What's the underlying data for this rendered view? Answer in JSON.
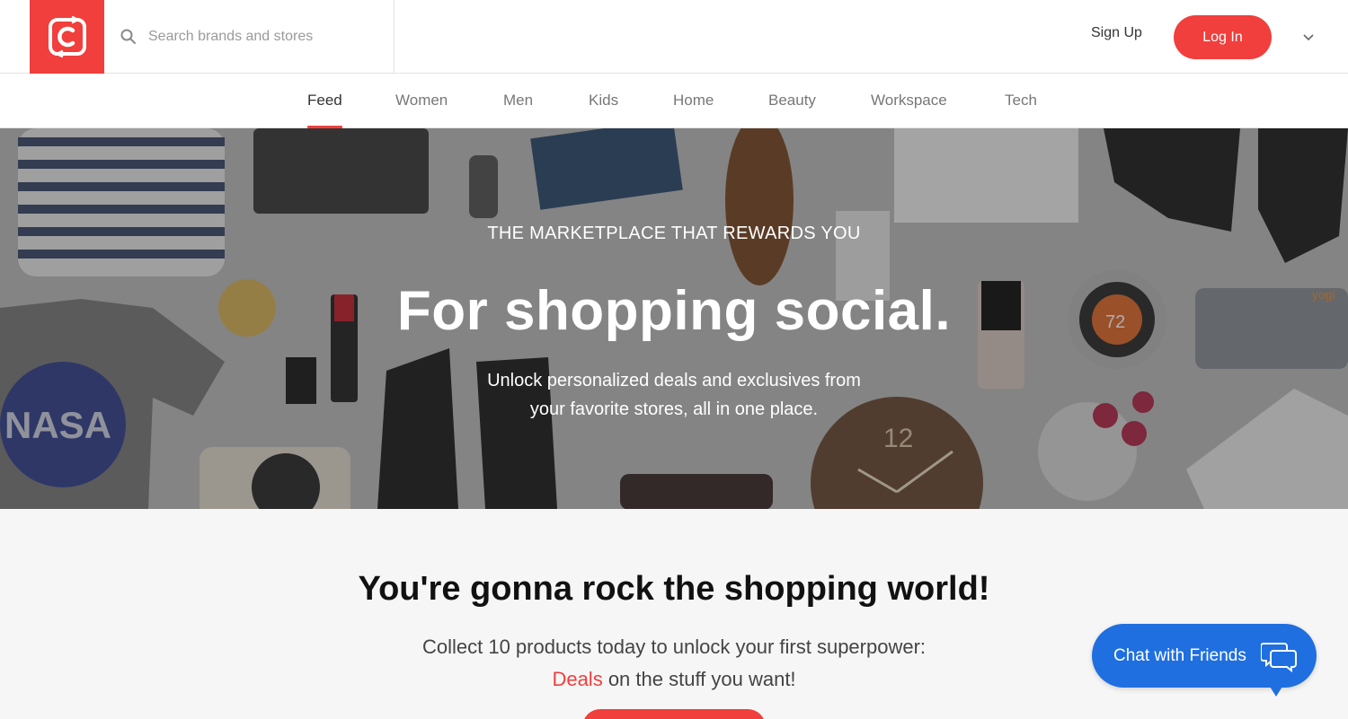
{
  "header": {
    "logo_alt": "C",
    "search": {
      "placeholder": "Search brands and stores",
      "icon": "search-icon"
    },
    "signup_label": "Sign Up",
    "login_label": "Log In",
    "menu_icon": "chevron-down-icon"
  },
  "nav": {
    "tabs": [
      {
        "label": "Feed",
        "active": true
      },
      {
        "label": "Women"
      },
      {
        "label": "Men"
      },
      {
        "label": "Kids"
      },
      {
        "label": "Home"
      },
      {
        "label": "Beauty"
      },
      {
        "label": "Workspace"
      },
      {
        "label": "Tech"
      }
    ]
  },
  "hero": {
    "eyebrow": "THE MARKETPLACE THAT REWARDS YOU",
    "title": "For shopping social.",
    "subtitle_line1": "Unlock personalized deals and exclusives from",
    "subtitle_line2": "your favorite stores, all in one place.",
    "collage_texts": {
      "tshirt": "NASA",
      "thermostat": "72",
      "clock": "12",
      "towel": "yogi"
    }
  },
  "promo": {
    "title": "You're gonna rock the shopping world!",
    "line1": "Collect 10 products today to unlock your first superpower:",
    "deals": "Deals",
    "line2_rest": " on the stuff you want!"
  },
  "chat": {
    "label": "Chat with Friends",
    "icon": "chat-bubbles-icon"
  },
  "colors": {
    "brand": "#f03f3c",
    "chat": "#1f6fe0"
  }
}
